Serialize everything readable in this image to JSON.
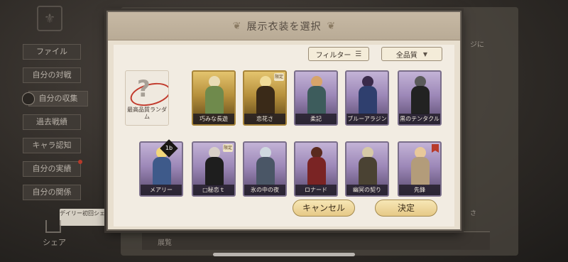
{
  "background": {
    "side_menu": [
      {
        "label": "ファイル",
        "active": false,
        "dot": false
      },
      {
        "label": "自分の対戦",
        "active": false,
        "dot": false
      },
      {
        "label": "自分の収集",
        "active": true,
        "dot": false
      },
      {
        "label": "過去戦績",
        "active": false,
        "dot": false
      },
      {
        "label": "キャラ認知",
        "active": false,
        "dot": false
      },
      {
        "label": "自分の実績",
        "active": false,
        "dot": true
      },
      {
        "label": "自分の関係",
        "active": false,
        "dot": false
      }
    ],
    "daily_tip": "デイリー初回シェア",
    "share_label": "シェア",
    "bottom_text": "展覧",
    "side_text": "ジに",
    "side_mini": "さ"
  },
  "dialog": {
    "title": "展示衣装を選択",
    "filter_label": "フィルター",
    "quality_label": "全品質",
    "cancel_label": "キャンセル",
    "confirm_label": "決定"
  },
  "cards": [
    {
      "name": "最高品質ランダム",
      "type": "random"
    },
    {
      "name": "巧みな長遊",
      "type": "gold",
      "head": "#e9dcb6",
      "body": "#6f8a4c",
      "badge": ""
    },
    {
      "name": "恋花さ",
      "type": "gold",
      "head": "#f0dc9a",
      "body": "#3a2a18",
      "badge": "限定"
    },
    {
      "name": "柔記",
      "type": "purple",
      "head": "#d7a46a",
      "body": "#3d5c5c",
      "badge": ""
    },
    {
      "name": "ブルーアラジン",
      "type": "purple",
      "head": "#3a2a4a",
      "body": "#2f3f6e",
      "badge": ""
    },
    {
      "name": "黒のテンタクル",
      "type": "purple",
      "head": "#5a5a5a",
      "body": "#222222",
      "badge": ""
    },
    {
      "name": "メアリー",
      "type": "purple",
      "head": "#f2d77a",
      "body": "#3e5a8a",
      "badge": ""
    },
    {
      "name": "□秘恋ｔ",
      "type": "purple",
      "head": "#d8d0c8",
      "body": "#1e1e1e",
      "badge": "限定"
    },
    {
      "name": "氷の中の夜",
      "type": "purple",
      "head": "#cfd8df",
      "body": "#4a5666",
      "badge": ""
    },
    {
      "name": "ロナード",
      "type": "purple",
      "head": "#5a2a1e",
      "body": "#7a2424",
      "badge": ""
    },
    {
      "name": "幽冥の契り",
      "type": "purple",
      "head": "#d6c9a6",
      "body": "#4a4233",
      "badge": ""
    },
    {
      "name": "先鋒",
      "type": "purple",
      "head": "#e8c89a",
      "body": "#b39c7a",
      "badge": "ribbon"
    }
  ],
  "diamond_badge": "1b"
}
